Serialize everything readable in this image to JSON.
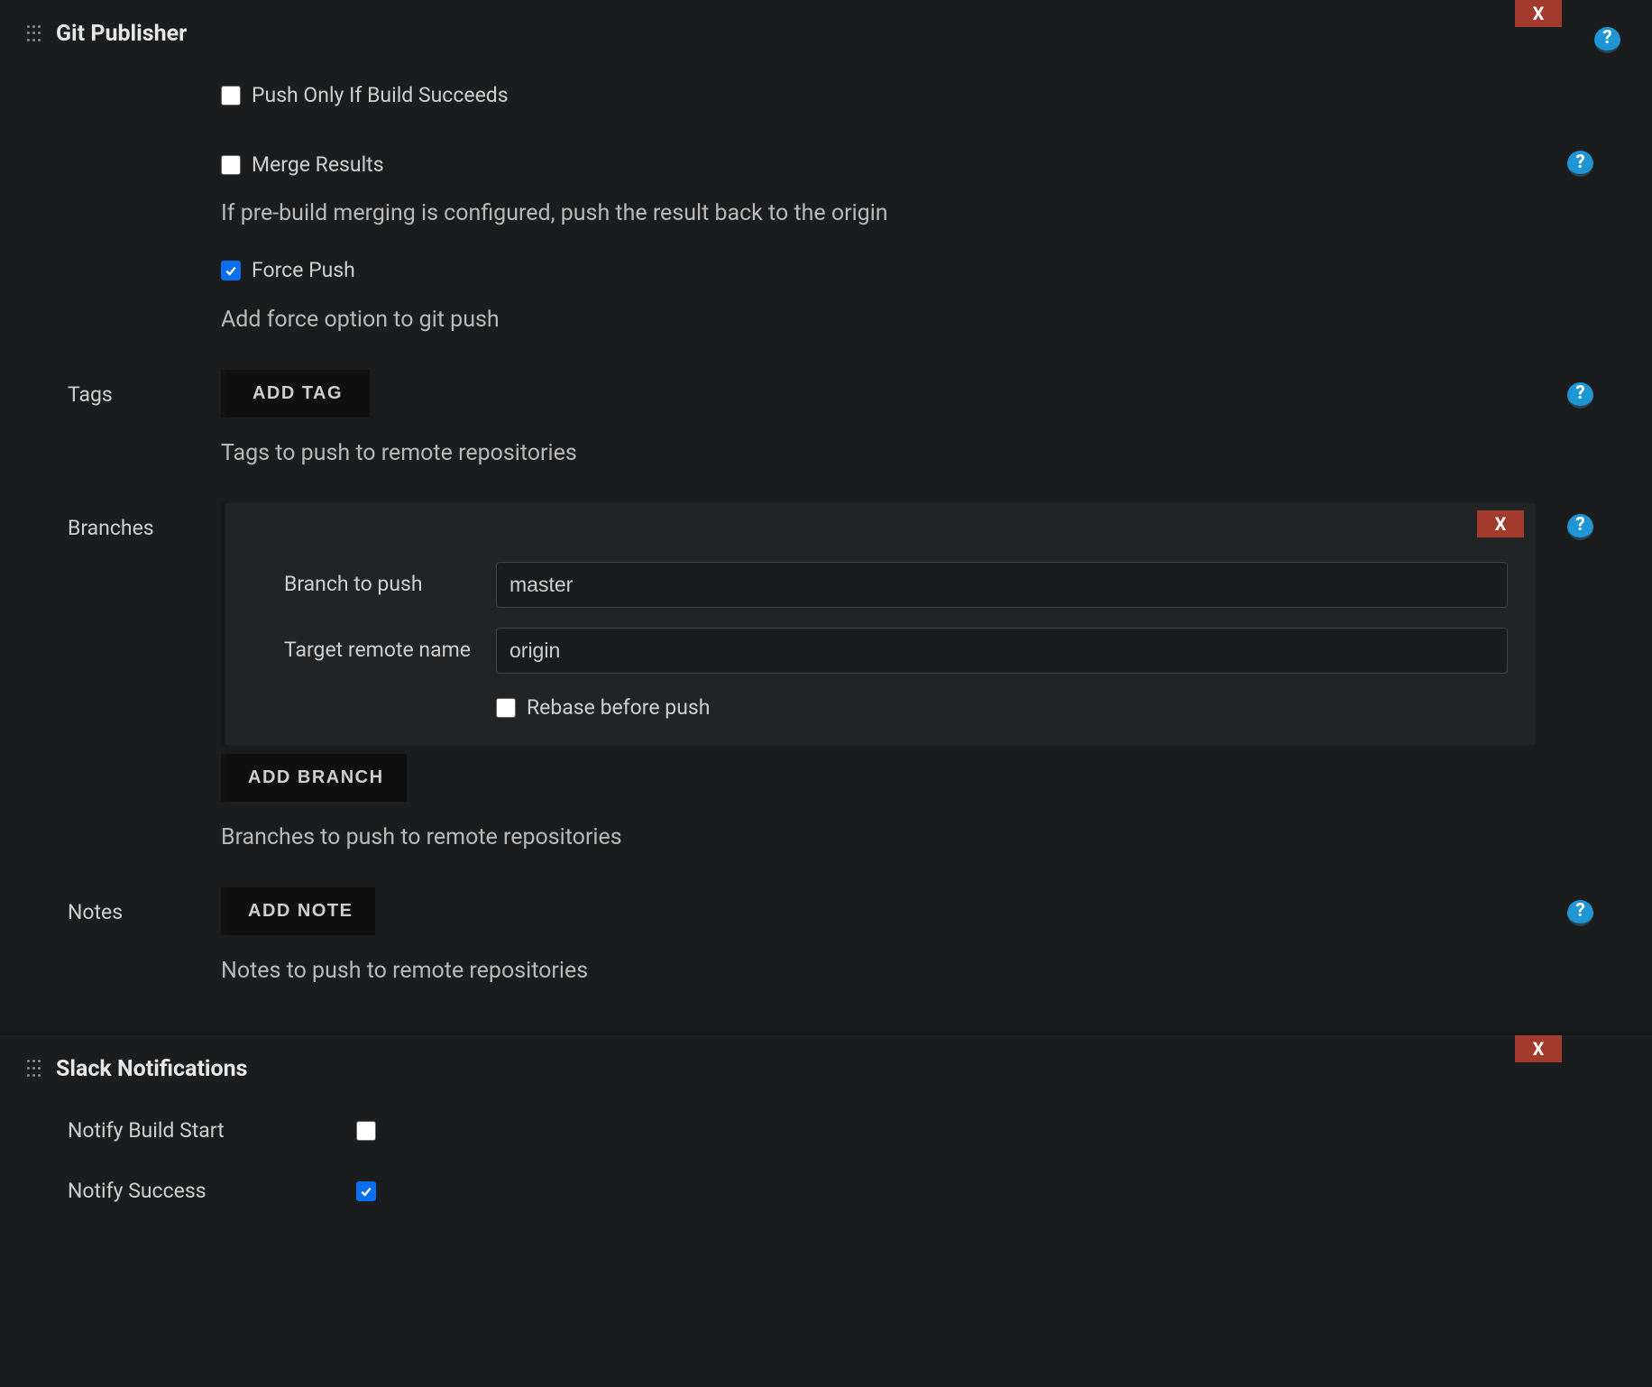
{
  "gitPublisher": {
    "title": "Git Publisher",
    "close": "X",
    "pushOnlyIfSucceeds": {
      "label": "Push Only If Build Succeeds",
      "checked": false
    },
    "mergeResults": {
      "label": "Merge Results",
      "checked": false,
      "desc": "If pre-build merging is configured, push the result back to the origin"
    },
    "forcePush": {
      "label": "Force Push",
      "checked": true,
      "desc": "Add force option to git push"
    },
    "tags": {
      "label": "Tags",
      "addButton": "ADD TAG",
      "desc": "Tags to push to remote repositories"
    },
    "branches": {
      "label": "Branches",
      "close": "X",
      "branchToPush": {
        "label": "Branch to push",
        "value": "master"
      },
      "targetRemote": {
        "label": "Target remote name",
        "value": "origin"
      },
      "rebaseBeforePush": {
        "label": "Rebase before push",
        "checked": false
      },
      "addButton": "ADD BRANCH",
      "desc": "Branches to push to remote repositories"
    },
    "notes": {
      "label": "Notes",
      "addButton": "ADD NOTE",
      "desc": "Notes to push to remote repositories"
    }
  },
  "slack": {
    "title": "Slack Notifications",
    "close": "X",
    "notifyBuildStart": {
      "label": "Notify Build Start",
      "checked": false
    },
    "notifySuccess": {
      "label": "Notify Success",
      "checked": true
    }
  }
}
